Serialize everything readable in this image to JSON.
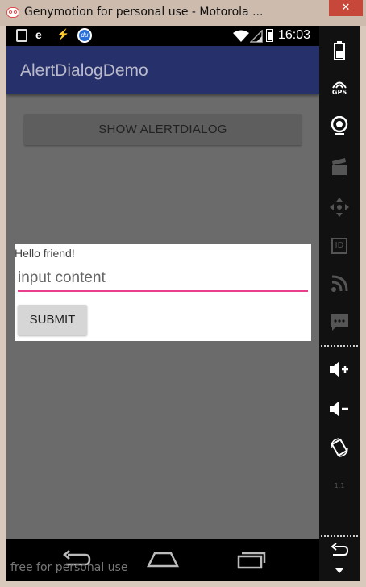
{
  "window": {
    "title": "Genymotion for personal use - Motorola ...",
    "close_label": "✕"
  },
  "statusbar": {
    "time": "16:03",
    "du_badge": "du"
  },
  "app": {
    "title": "AlertDialogDemo",
    "show_button_label": "SHOW ALERTDIALOG"
  },
  "dialog": {
    "message": "Hello friend!",
    "input_placeholder": "input content",
    "input_value": "",
    "submit_label": "SUBMIT",
    "accent_color": "#e83e8c"
  },
  "watermark": "free for personal use",
  "toolbar": {
    "gps_label": "GPS",
    "id_label": "ID",
    "ratio_label": "1:1",
    "items": [
      "battery-icon",
      "gps-icon",
      "camera-icon",
      "clapper-icon",
      "dpad-icon",
      "id-icon",
      "rss-icon",
      "sms-icon",
      "volume-up-icon",
      "volume-down-icon",
      "rotate-icon",
      "scale-icon",
      "back-icon",
      "menu-down-icon"
    ]
  }
}
